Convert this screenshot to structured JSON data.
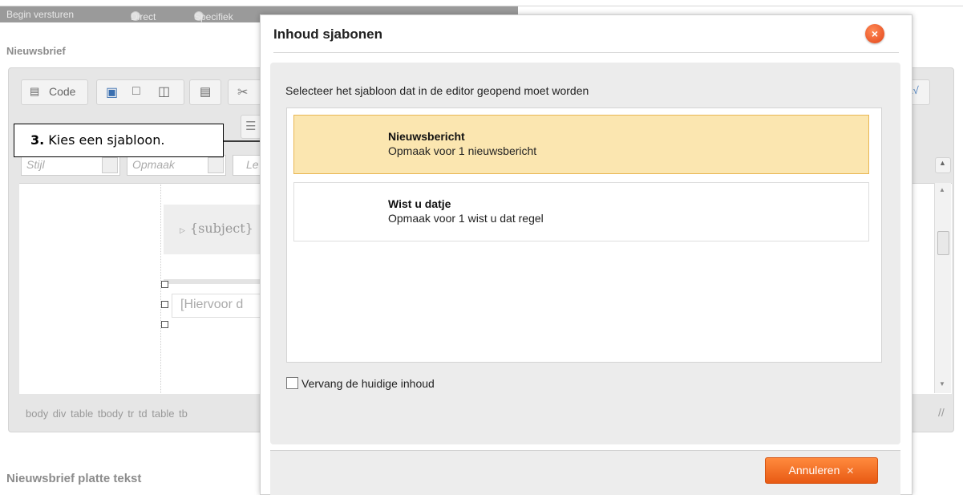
{
  "background": {
    "send_label": "Begin versturen",
    "radio_direct": "Direct",
    "radio_specific": "Specifiek",
    "newsletter_section": "Nieuwsbrief",
    "plain_text_section": "Nieuwsbrief platte tekst",
    "toolbar_code": "Code",
    "style_select": "Stijl",
    "format_select": "Opmaak",
    "third_select": "Le",
    "subject_tag": "{subject}",
    "placeholder_text": "[Hiervoor d",
    "status_path": "body div table tbody tr td table tb"
  },
  "callout": {
    "step": "3.",
    "text": " Kies een sjabloon."
  },
  "dialog": {
    "title": "Inhoud sjabonen",
    "instruction": "Selecteer het sjabloon dat in de editor geopend moet worden",
    "templates": [
      {
        "name": "Nieuwsbericht",
        "description": "Opmaak voor 1 nieuwsbericht",
        "selected": true
      },
      {
        "name": "Wist u datje",
        "description": "Opmaak voor 1 wist u dat regel",
        "selected": false
      }
    ],
    "replace_checkbox_label": "Vervang de huidige inhoud",
    "replace_checkbox_checked": false,
    "cancel_label": "Annuleren",
    "close_icon_glyph": "×"
  },
  "colors": {
    "accent_orange": "#e85a14",
    "selected_item_bg": "#fbe6b0"
  }
}
